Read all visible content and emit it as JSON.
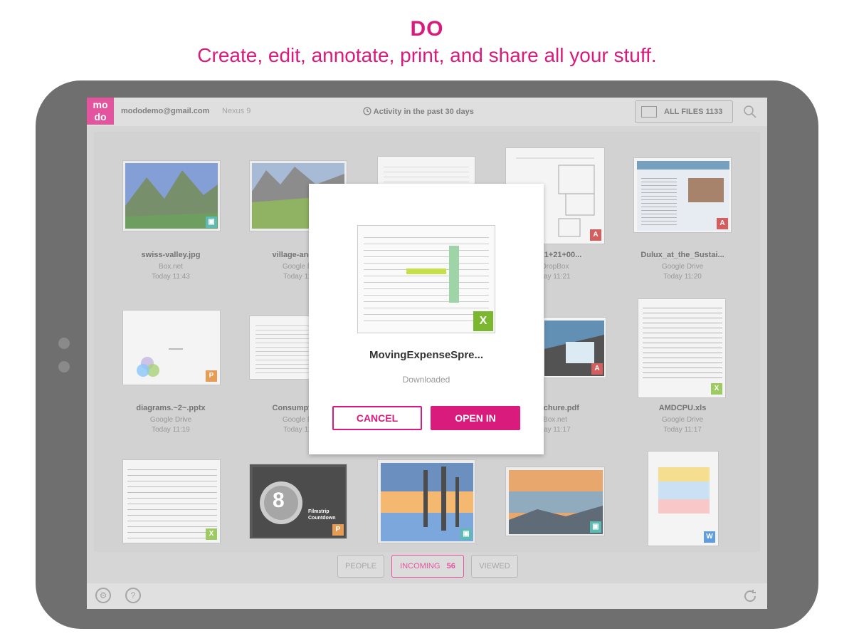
{
  "promo": {
    "heading": "DO",
    "tagline": "Create, edit, annotate, print, and share all your stuff."
  },
  "topbar": {
    "logo": "mo do",
    "account": "mododemo@gmail.com",
    "device": "Nexus 9",
    "activity": "Activity in the past 30 days",
    "all_files": "ALL FILES 1133"
  },
  "files": [
    {
      "name": "swiss-valley.jpg",
      "source": "Box.net",
      "time": "Today 11:43",
      "badge": "image"
    },
    {
      "name": "village-and-m",
      "source": "Google D",
      "time": "Today 11",
      "badge": "image"
    },
    {
      "name": "",
      "source": "",
      "time": "",
      "badge": ""
    },
    {
      "name": "lan l1+21+00...",
      "source": "DropBox",
      "time": "day 11:21",
      "badge": "pdf"
    },
    {
      "name": "Dulux_at_the_Sustai...",
      "source": "Google Drive",
      "time": "Today 11:20",
      "badge": "pdf"
    },
    {
      "name": "diagrams.~2~.pptx",
      "source": "Google Drive",
      "time": "Today 11:19",
      "badge": "ppt"
    },
    {
      "name": "Consumption",
      "source": "Google D",
      "time": "Today 11",
      "badge": ""
    },
    {
      "name": "",
      "source": "",
      "time": "",
      "badge": ""
    },
    {
      "name": "brochure.pdf",
      "source": "Box.net",
      "time": "day 11:17",
      "badge": "pdf"
    },
    {
      "name": "AMDCPU.xls",
      "source": "Google Drive",
      "time": "Today 11:17",
      "badge": "excel"
    }
  ],
  "tiles_row3": {
    "countdown_number": "8",
    "countdown_label": "Filmstrip Countdown"
  },
  "tabs": {
    "people": "PEOPLE",
    "incoming": "INCOMING",
    "incoming_count": "56",
    "viewed": "VIEWED"
  },
  "dialog": {
    "filename": "MovingExpenseSpre...",
    "status": "Downloaded",
    "cancel": "CANCEL",
    "open_in": "OPEN IN"
  },
  "colors": {
    "accent": "#d81b7d",
    "excel": "#7cb82f",
    "pdf": "#c62828",
    "ppt": "#e07b1a",
    "image": "#26a69a",
    "word": "#2b7cd3"
  }
}
